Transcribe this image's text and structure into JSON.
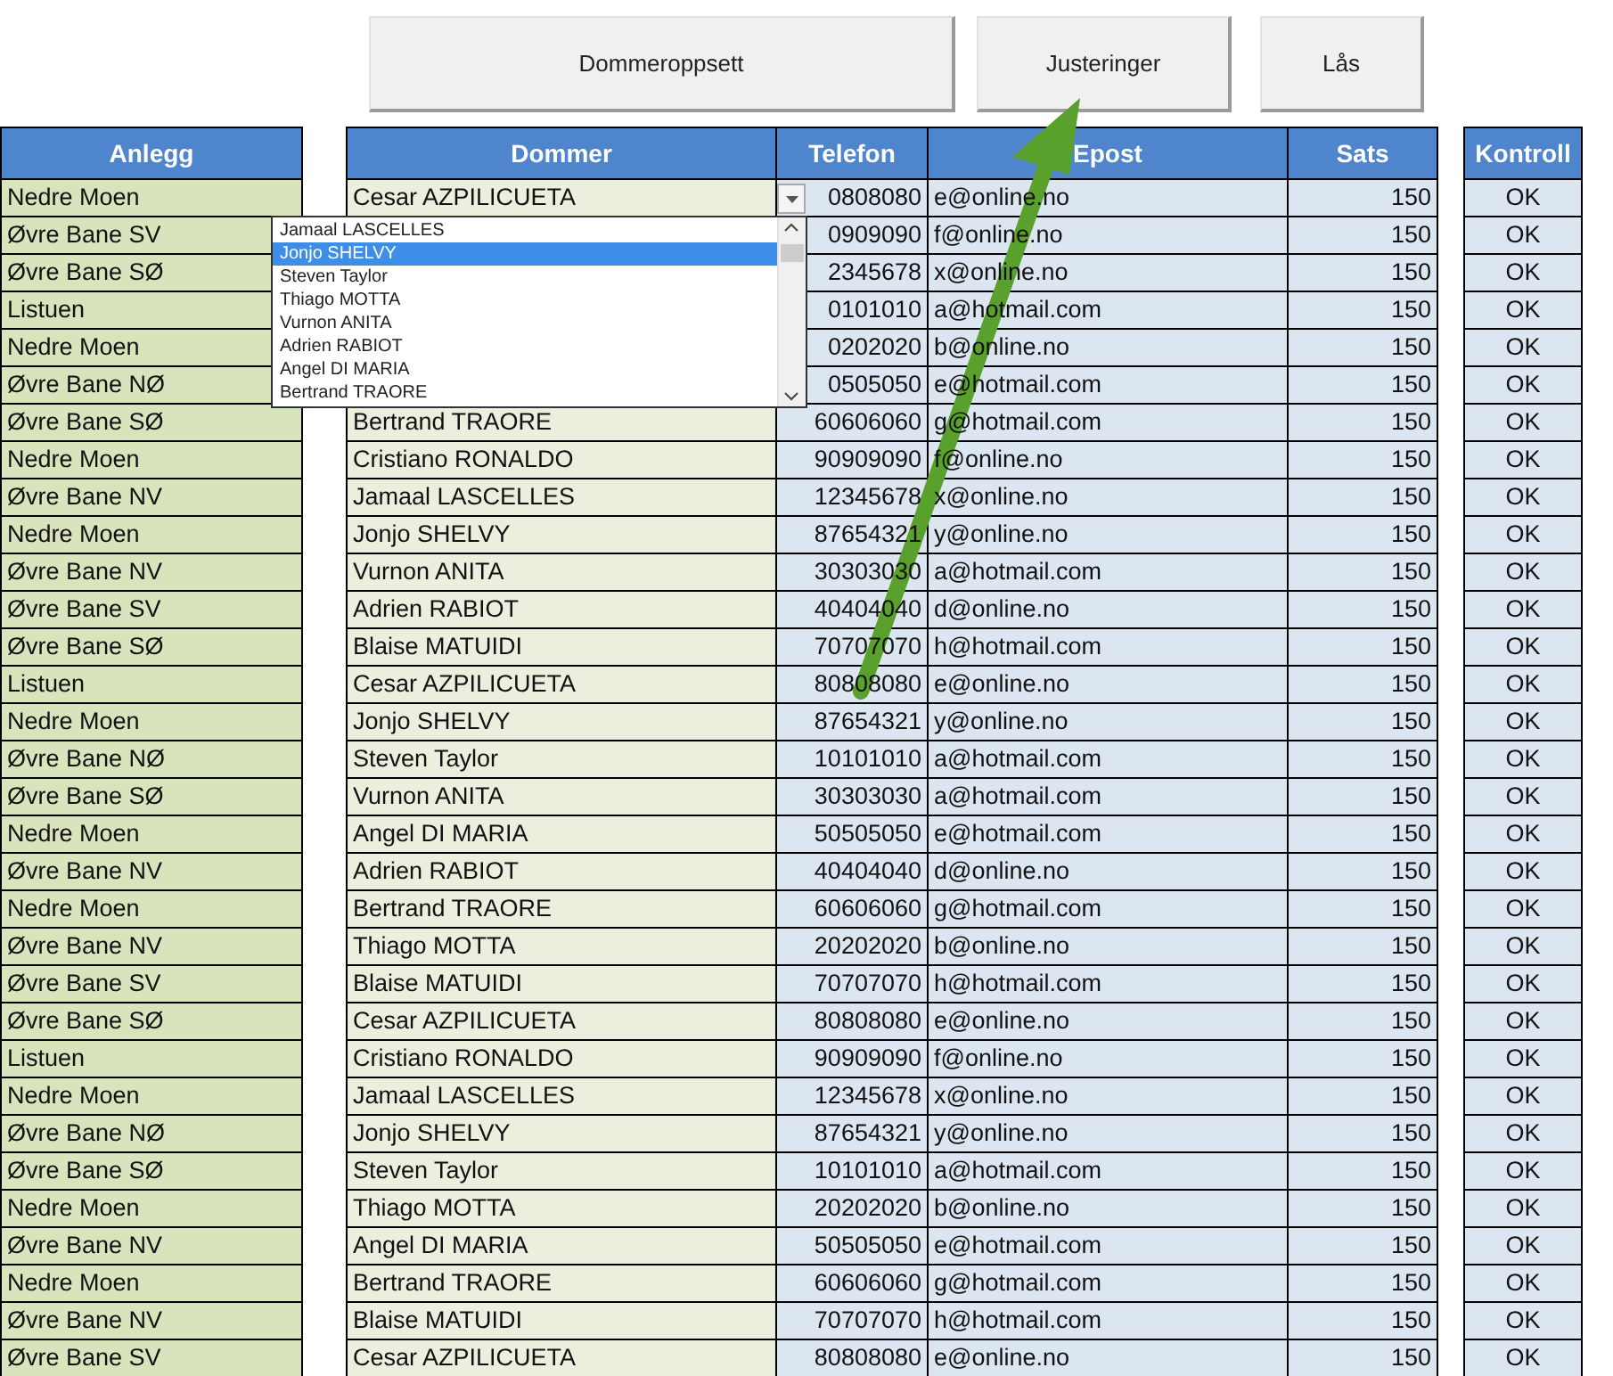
{
  "buttons": [
    {
      "label": "Dommeroppsett"
    },
    {
      "label": "Justeringer"
    },
    {
      "label": "Lås"
    }
  ],
  "columns": [
    "Anlegg",
    "Dommer",
    "Telefon",
    "Epost",
    "Sats",
    "Kontroll"
  ],
  "rows": [
    {
      "anlegg": "Nedre Moen",
      "dommer": "Cesar AZPILICUETA",
      "telefon": "0808080",
      "epost": "e@online.no",
      "sats": "150",
      "kontroll": "OK"
    },
    {
      "anlegg": "Øvre Bane SV",
      "telefon": "0909090",
      "epost": "f@online.no",
      "sats": "150",
      "kontroll": "OK"
    },
    {
      "anlegg": "Øvre Bane SØ",
      "telefon": "2345678",
      "epost": "x@online.no",
      "sats": "150",
      "kontroll": "OK"
    },
    {
      "anlegg": "Listuen",
      "telefon": "0101010",
      "epost": "a@hotmail.com",
      "sats": "150",
      "kontroll": "OK"
    },
    {
      "anlegg": "Nedre Moen",
      "telefon": "0202020",
      "epost": "b@online.no",
      "sats": "150",
      "kontroll": "OK"
    },
    {
      "anlegg": "Øvre Bane NØ",
      "telefon": "0505050",
      "epost": "e@hotmail.com",
      "sats": "150",
      "kontroll": "OK"
    },
    {
      "anlegg": "Øvre Bane SØ",
      "dommer": "Bertrand TRAORE",
      "telefon": "60606060",
      "epost": "g@hotmail.com",
      "sats": "150",
      "kontroll": "OK"
    },
    {
      "anlegg": "Nedre Moen",
      "dommer": "Cristiano RONALDO",
      "telefon": "90909090",
      "epost": "f@online.no",
      "sats": "150",
      "kontroll": "OK"
    },
    {
      "anlegg": "Øvre Bane NV",
      "dommer": "Jamaal LASCELLES",
      "telefon": "12345678",
      "epost": "x@online.no",
      "sats": "150",
      "kontroll": "OK"
    },
    {
      "anlegg": "Nedre Moen",
      "dommer": "Jonjo SHELVY",
      "telefon": "87654321",
      "epost": "y@online.no",
      "sats": "150",
      "kontroll": "OK"
    },
    {
      "anlegg": "Øvre Bane NV",
      "dommer": "Vurnon ANITA",
      "telefon": "30303030",
      "epost": "a@hotmail.com",
      "sats": "150",
      "kontroll": "OK"
    },
    {
      "anlegg": "Øvre Bane SV",
      "dommer": "Adrien RABIOT",
      "telefon": "40404040",
      "epost": "d@online.no",
      "sats": "150",
      "kontroll": "OK"
    },
    {
      "anlegg": "Øvre Bane SØ",
      "dommer": "Blaise MATUIDI",
      "telefon": "70707070",
      "epost": "h@hotmail.com",
      "sats": "150",
      "kontroll": "OK"
    },
    {
      "anlegg": "Listuen",
      "dommer": "Cesar AZPILICUETA",
      "telefon": "80808080",
      "epost": "e@online.no",
      "sats": "150",
      "kontroll": "OK"
    },
    {
      "anlegg": "Nedre Moen",
      "dommer": "Jonjo SHELVY",
      "telefon": "87654321",
      "epost": "y@online.no",
      "sats": "150",
      "kontroll": "OK"
    },
    {
      "anlegg": "Øvre Bane NØ",
      "dommer": "Steven Taylor",
      "telefon": "10101010",
      "epost": "a@hotmail.com",
      "sats": "150",
      "kontroll": "OK"
    },
    {
      "anlegg": "Øvre Bane SØ",
      "dommer": "Vurnon ANITA",
      "telefon": "30303030",
      "epost": "a@hotmail.com",
      "sats": "150",
      "kontroll": "OK"
    },
    {
      "anlegg": "Nedre Moen",
      "dommer": "Angel DI MARIA",
      "telefon": "50505050",
      "epost": "e@hotmail.com",
      "sats": "150",
      "kontroll": "OK"
    },
    {
      "anlegg": "Øvre Bane NV",
      "dommer": "Adrien RABIOT",
      "telefon": "40404040",
      "epost": "d@online.no",
      "sats": "150",
      "kontroll": "OK"
    },
    {
      "anlegg": "Nedre Moen",
      "dommer": "Bertrand TRAORE",
      "telefon": "60606060",
      "epost": "g@hotmail.com",
      "sats": "150",
      "kontroll": "OK"
    },
    {
      "anlegg": "Øvre Bane NV",
      "dommer": "Thiago MOTTA",
      "telefon": "20202020",
      "epost": "b@online.no",
      "sats": "150",
      "kontroll": "OK"
    },
    {
      "anlegg": "Øvre Bane SV",
      "dommer": "Blaise MATUIDI",
      "telefon": "70707070",
      "epost": "h@hotmail.com",
      "sats": "150",
      "kontroll": "OK"
    },
    {
      "anlegg": "Øvre Bane SØ",
      "dommer": "Cesar AZPILICUETA",
      "telefon": "80808080",
      "epost": "e@online.no",
      "sats": "150",
      "kontroll": "OK"
    },
    {
      "anlegg": "Listuen",
      "dommer": "Cristiano RONALDO",
      "telefon": "90909090",
      "epost": "f@online.no",
      "sats": "150",
      "kontroll": "OK"
    },
    {
      "anlegg": "Nedre Moen",
      "dommer": "Jamaal LASCELLES",
      "telefon": "12345678",
      "epost": "x@online.no",
      "sats": "150",
      "kontroll": "OK"
    },
    {
      "anlegg": "Øvre Bane NØ",
      "dommer": "Jonjo SHELVY",
      "telefon": "87654321",
      "epost": "y@online.no",
      "sats": "150",
      "kontroll": "OK"
    },
    {
      "anlegg": "Øvre Bane SØ",
      "dommer": "Steven Taylor",
      "telefon": "10101010",
      "epost": "a@hotmail.com",
      "sats": "150",
      "kontroll": "OK"
    },
    {
      "anlegg": "Nedre Moen",
      "dommer": "Thiago MOTTA",
      "telefon": "20202020",
      "epost": "b@online.no",
      "sats": "150",
      "kontroll": "OK"
    },
    {
      "anlegg": "Øvre Bane NV",
      "dommer": "Angel DI MARIA",
      "telefon": "50505050",
      "epost": "e@hotmail.com",
      "sats": "150",
      "kontroll": "OK"
    },
    {
      "anlegg": "Nedre Moen",
      "dommer": "Bertrand TRAORE",
      "telefon": "60606060",
      "epost": "g@hotmail.com",
      "sats": "150",
      "kontroll": "OK"
    },
    {
      "anlegg": "Øvre Bane NV",
      "dommer": "Blaise MATUIDI",
      "telefon": "70707070",
      "epost": "h@hotmail.com",
      "sats": "150",
      "kontroll": "OK"
    },
    {
      "anlegg": "Øvre Bane SV",
      "dommer": "Cesar AZPILICUETA",
      "telefon": "80808080",
      "epost": "e@online.no",
      "sats": "150",
      "kontroll": "OK"
    }
  ],
  "dropdown": {
    "items": [
      {
        "label": "Jamaal LASCELLES",
        "selected": false
      },
      {
        "label": "Jonjo SHELVY",
        "selected": true
      },
      {
        "label": "Steven Taylor",
        "selected": false
      },
      {
        "label": "Thiago MOTTA",
        "selected": false
      },
      {
        "label": "Vurnon ANITA",
        "selected": false
      },
      {
        "label": "Adrien RABIOT",
        "selected": false
      },
      {
        "label": "Angel DI MARIA",
        "selected": false
      },
      {
        "label": "Bertrand TRAORE",
        "selected": false
      }
    ]
  }
}
